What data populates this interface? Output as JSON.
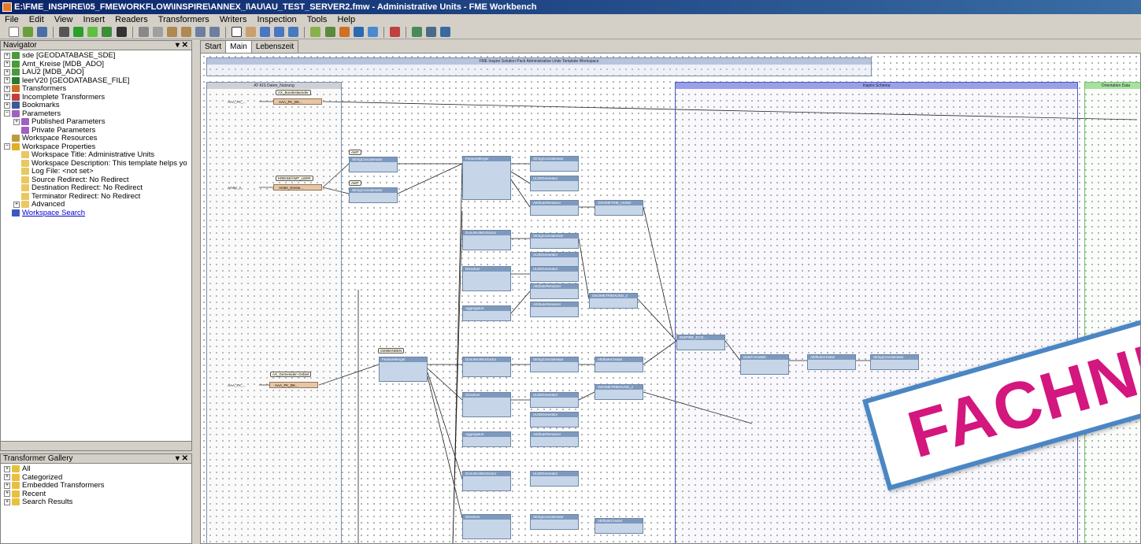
{
  "window": {
    "title": "E:\\FME_INSPIRE\\05_FMEWORKFLOW\\INSPIRE\\ANNEX_I\\AU\\AU_TEST_SERVER2.fmw - Administrative Units - FME Workbench"
  },
  "menu": [
    "File",
    "Edit",
    "View",
    "Insert",
    "Readers",
    "Transformers",
    "Writers",
    "Inspection",
    "Tools",
    "Help"
  ],
  "navigator": {
    "title": "Navigator",
    "controls": "▾ ✕",
    "items": [
      {
        "label": "sde [GEODATABASE_SDE]",
        "icon": "reader-icon",
        "exp": "+"
      },
      {
        "label": "Amt_Kreise [MDB_ADO]",
        "icon": "reader-icon",
        "exp": "+"
      },
      {
        "label": "LAU2 [MDB_ADO]",
        "icon": "reader-icon",
        "exp": "+"
      },
      {
        "label": "leerV20 [GEODATABASE_FILE]",
        "icon": "writer-icon",
        "exp": "+"
      },
      {
        "label": "Transformers",
        "icon": "transformers-icon",
        "exp": "+"
      },
      {
        "label": "Incomplete Transformers",
        "icon": "incomplete-icon",
        "exp": "+"
      },
      {
        "label": "Bookmarks",
        "icon": "bookmarks-icon",
        "exp": "+"
      },
      {
        "label": "Parameters",
        "icon": "parameters-icon",
        "exp": "−"
      },
      {
        "label": "Published Parameters",
        "icon": "published-params-icon",
        "exp": "+",
        "indent": 1
      },
      {
        "label": "Private Parameters",
        "icon": "private-params-icon",
        "exp": "",
        "indent": 1
      },
      {
        "label": "Workspace Resources",
        "icon": "resources-icon",
        "exp": ""
      },
      {
        "label": "Workspace Properties",
        "icon": "properties-icon",
        "exp": "−"
      },
      {
        "label": "Workspace Title: Administrative Units",
        "icon": "property-icon",
        "exp": "",
        "indent": 1
      },
      {
        "label": "Workspace Description: This template helps yo",
        "icon": "property-icon",
        "exp": "",
        "indent": 1
      },
      {
        "label": "Log File: <not set>",
        "icon": "property-icon",
        "exp": "",
        "indent": 1
      },
      {
        "label": "Source Redirect: No Redirect",
        "icon": "property-icon",
        "exp": "",
        "indent": 1
      },
      {
        "label": "Destination Redirect: No Redirect",
        "icon": "property-icon",
        "exp": "",
        "indent": 1
      },
      {
        "label": "Terminator Redirect: No Redirect",
        "icon": "property-icon",
        "exp": "",
        "indent": 1
      },
      {
        "label": "Advanced",
        "icon": "property-icon",
        "exp": "+",
        "indent": 1
      },
      {
        "label": "Workspace Search",
        "icon": "binoculars-icon",
        "exp": "",
        "link": true
      }
    ]
  },
  "gallery": {
    "title": "Transformer Gallery",
    "controls": "▾ ✕",
    "items": [
      "All",
      "Categorized",
      "Embedded Transformers",
      "Recent",
      "Search Results"
    ]
  },
  "tabs": [
    "Start",
    "Main",
    "Lebenszeit"
  ],
  "active_tab": "Main",
  "canvas": {
    "header_bookmark": "FME Inspire Solution Pack Administrative Units Template Workspace",
    "bookmarks": [
      "AT-KIS Daten_Nutzung",
      "Inspire Schema",
      "Orientation Data"
    ],
    "feature_types": [
      "AAA_FK_...",
      "AAA_FK_DK...",
      "Amter_Kreise...",
      "Amter_2",
      "AAA_FK_...",
      "AAA_FK_DK..."
    ],
    "labels": [
      "AX_Bundeslaender",
      "KREISE/AMT_LEER",
      "AX_Gemeinden Gebiet",
      "AMT",
      "KREIS",
      "LAND",
      "GEMEINDEN"
    ],
    "transformers": [
      "StringConcatenator",
      "FeatureMerger",
      "StringConcatenator",
      "DonutHoleExtractor",
      "Dissolver",
      "AggregatorI",
      "StringConcatenator",
      "UUIDGenerator",
      "AttributeRenamer",
      "INSPIRE_ECO...",
      "GEOMETRIE_HUND",
      "GEOMETRIEHUND_2",
      "AttributeCreator",
      "DateFormatter"
    ]
  },
  "watermark": "FACHNETZWERK"
}
